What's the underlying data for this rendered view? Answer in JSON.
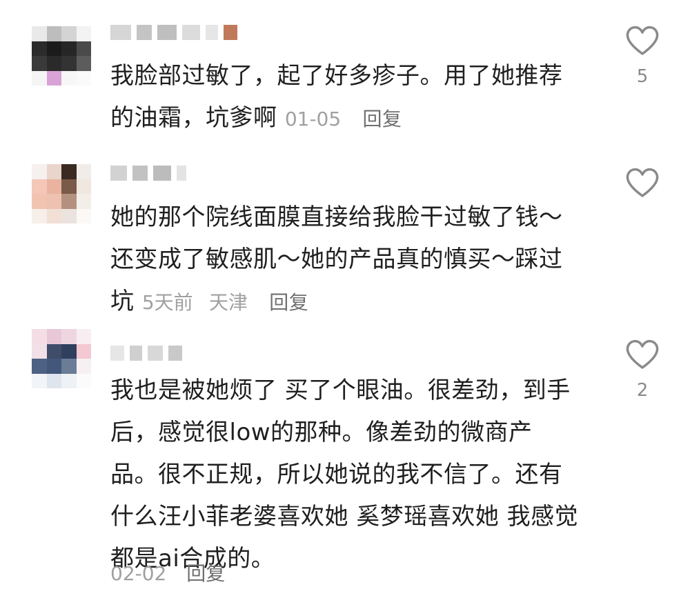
{
  "comments": [
    {
      "text": "我脸部过敏了，起了好多疹子。用了她推荐的油霜，坑爹啊",
      "date": "01-05",
      "location": "",
      "reply_label": "回复",
      "like_count": "5",
      "like_icon": "heart-outline-icon"
    },
    {
      "text": "她的那个院线面膜直接给我脸干过敏了钱～还变成了敏感肌～她的产品真的慎买～踩过坑",
      "date": "5天前",
      "location": "天津",
      "reply_label": "回复",
      "like_count": "",
      "like_icon": "heart-outline-icon"
    },
    {
      "text": "我也是被她烦了 买了个眼油。很差劲，到手后，感觉很low的那种。像差劲的微商产品。很不正规，所以她说的我不信了。还有什么汪小菲老婆喜欢她 奚梦瑶喜欢她 我感觉都是ai合成的。",
      "date": "02-02",
      "location": "",
      "reply_label": "回复",
      "like_count": "2",
      "like_icon": "heart-outline-icon"
    }
  ],
  "colors": {
    "text": "#1f1f1f",
    "meta": "#a0a0a0",
    "reply": "#6f6f6f",
    "icon": "#8a8a8a"
  }
}
